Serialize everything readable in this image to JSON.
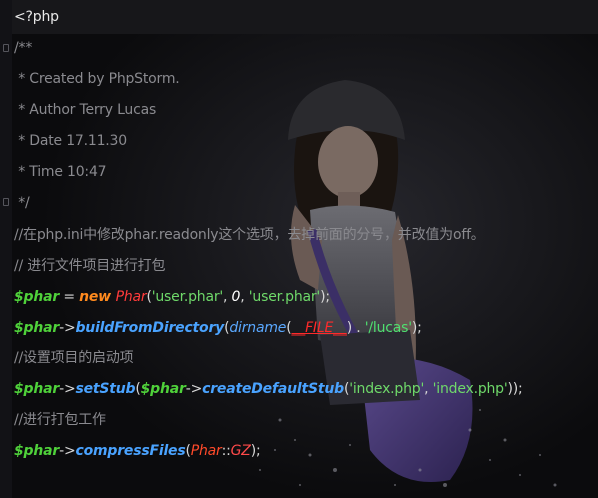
{
  "editor": {
    "lines": [
      {
        "id": "php-open",
        "segments": [
          {
            "cls": "php-open",
            "text": "<?php"
          }
        ]
      },
      {
        "id": "doc-start",
        "segments": [
          {
            "cls": "cmt",
            "text": "/**"
          }
        ]
      },
      {
        "id": "doc-created",
        "segments": [
          {
            "cls": "cmt",
            "text": " * Created by PhpStorm."
          }
        ]
      },
      {
        "id": "doc-author",
        "segments": [
          {
            "cls": "cmt",
            "text": " * Author Terry Lucas"
          }
        ]
      },
      {
        "id": "doc-date",
        "segments": [
          {
            "cls": "cmt",
            "text": " * Date 17.11.30"
          }
        ]
      },
      {
        "id": "doc-time",
        "segments": [
          {
            "cls": "cmt",
            "text": " * Time 10:47"
          }
        ]
      },
      {
        "id": "doc-end",
        "segments": [
          {
            "cls": "cmt",
            "text": " */"
          }
        ]
      },
      {
        "id": "comment-ini",
        "segments": [
          {
            "cls": "cmt",
            "text": "//在php.ini中修改phar.readonly这个选项，去掉前面的分号，并改值为off。"
          }
        ]
      },
      {
        "id": "comment-pack",
        "segments": [
          {
            "cls": "cmt",
            "text": "// 进行文件项目进行打包"
          }
        ]
      },
      {
        "id": "code-new-phar",
        "segments": [
          {
            "cls": "var",
            "text": "$phar"
          },
          {
            "cls": "op",
            "text": " = "
          },
          {
            "cls": "kw",
            "text": "new "
          },
          {
            "cls": "cls",
            "text": "Phar"
          },
          {
            "cls": "punc",
            "text": "("
          },
          {
            "cls": "str",
            "text": "'user.phar'"
          },
          {
            "cls": "punc",
            "text": ", "
          },
          {
            "cls": "num",
            "text": "0"
          },
          {
            "cls": "punc",
            "text": ", "
          },
          {
            "cls": "str",
            "text": "'user.phar'"
          },
          {
            "cls": "punc",
            "text": ");"
          }
        ]
      },
      {
        "id": "code-build",
        "segments": [
          {
            "cls": "var",
            "text": "$phar"
          },
          {
            "cls": "op",
            "text": "->"
          },
          {
            "cls": "meth",
            "text": "buildFromDirectory"
          },
          {
            "cls": "punc",
            "text": "("
          },
          {
            "cls": "fn",
            "text": "dirname"
          },
          {
            "cls": "punc",
            "text": "("
          },
          {
            "cls": "const",
            "text": "__FILE__"
          },
          {
            "cls": "punc",
            "text": ") . "
          },
          {
            "cls": "str2",
            "text": "'/lucas'"
          },
          {
            "cls": "punc",
            "text": ");"
          }
        ]
      },
      {
        "id": "comment-startup",
        "segments": [
          {
            "cls": "cmt",
            "text": "//设置项目的启动项"
          }
        ]
      },
      {
        "id": "code-setstub",
        "segments": [
          {
            "cls": "var",
            "text": "$phar"
          },
          {
            "cls": "op",
            "text": "->"
          },
          {
            "cls": "meth",
            "text": "setStub"
          },
          {
            "cls": "punc",
            "text": "("
          },
          {
            "cls": "var",
            "text": "$phar"
          },
          {
            "cls": "op",
            "text": "->"
          },
          {
            "cls": "meth",
            "text": "createDefaultStub"
          },
          {
            "cls": "punc",
            "text": "("
          },
          {
            "cls": "str",
            "text": "'index.php'"
          },
          {
            "cls": "punc",
            "text": ", "
          },
          {
            "cls": "str",
            "text": "'index.php'"
          },
          {
            "cls": "punc",
            "text": "));"
          }
        ]
      },
      {
        "id": "comment-compress",
        "segments": [
          {
            "cls": "cmt",
            "text": "//进行打包工作"
          }
        ]
      },
      {
        "id": "code-compress",
        "segments": [
          {
            "cls": "var",
            "text": "$phar"
          },
          {
            "cls": "op",
            "text": "->"
          },
          {
            "cls": "meth",
            "text": "compressFiles"
          },
          {
            "cls": "punc",
            "text": "("
          },
          {
            "cls": "cls2",
            "text": "Phar"
          },
          {
            "cls": "op",
            "text": "::"
          },
          {
            "cls": "const2",
            "text": "GZ"
          },
          {
            "cls": "punc",
            "text": ");"
          }
        ]
      }
    ]
  },
  "background": {
    "icon": "portrait-photo-image"
  },
  "colors": {
    "background": "#0d0d10",
    "comment": "#8a8a8f",
    "variable": "#4fd13a",
    "keyword": "#ff8a1e",
    "class": "#ff3b3b",
    "method": "#4aa3ff",
    "string": "#6fd96a"
  }
}
